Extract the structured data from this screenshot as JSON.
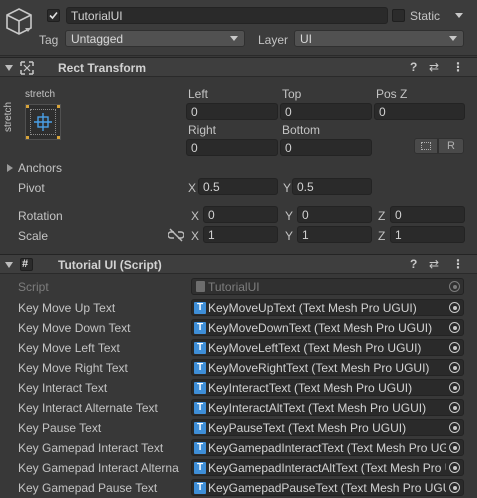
{
  "header": {
    "object_name": "TutorialUI",
    "active_checked": true,
    "static_label": "Static",
    "tag_label": "Tag",
    "tag_value": "Untagged",
    "layer_label": "Layer",
    "layer_value": "UI"
  },
  "rect_transform": {
    "title": "Rect Transform",
    "stretch_top": "stretch",
    "stretch_side": "stretch",
    "col_left": "Left",
    "col_top": "Top",
    "col_posz": "Pos Z",
    "left_value": "0",
    "top_value": "0",
    "posz_value": "0",
    "col_right": "Right",
    "col_bottom": "Bottom",
    "right_value": "0",
    "bottom_value": "0",
    "r_button": "R",
    "anchors_label": "Anchors",
    "pivot_label": "Pivot",
    "pivot_x_label": "X",
    "pivot_x": "0.5",
    "pivot_y_label": "Y",
    "pivot_y": "0.5",
    "rotation_label": "Rotation",
    "rot_x_label": "X",
    "rot_x": "0",
    "rot_y_label": "Y",
    "rot_y": "0",
    "rot_z_label": "Z",
    "rot_z": "0",
    "scale_label": "Scale",
    "scale_x_label": "X",
    "scale_x": "1",
    "scale_y_label": "Y",
    "scale_y": "1",
    "scale_z_label": "Z",
    "scale_z": "1"
  },
  "script_component": {
    "title": "Tutorial UI (Script)",
    "script_label": "Script",
    "script_value": "TutorialUI",
    "fields": [
      {
        "label": "Key Move Up Text",
        "value": "KeyMoveUpText (Text Mesh Pro UGUI)"
      },
      {
        "label": "Key Move Down Text",
        "value": "KeyMoveDownText (Text Mesh Pro UGUI)"
      },
      {
        "label": "Key Move Left Text",
        "value": "KeyMoveLeftText (Text Mesh Pro UGUI)"
      },
      {
        "label": "Key Move Right Text",
        "value": "KeyMoveRightText (Text Mesh Pro UGUI)"
      },
      {
        "label": "Key Interact Text",
        "value": "KeyInteractText (Text Mesh Pro UGUI)"
      },
      {
        "label": "Key Interact Alternate Text",
        "value": "KeyInteractAltText (Text Mesh Pro UGUI)"
      },
      {
        "label": "Key Pause Text",
        "value": "KeyPauseText (Text Mesh Pro UGUI)"
      },
      {
        "label": "Key Gamepad Interact Text",
        "value": "KeyGamepadInteractText (Text Mesh Pro UGUI)"
      },
      {
        "label": "Key Gamepad Interact Alterna",
        "value": "KeyGamepadInteractAltText (Text Mesh Pro UGUI)"
      },
      {
        "label": "Key Gamepad Pause Text",
        "value": "KeyGamepadPauseText (Text Mesh Pro UGUI)"
      }
    ]
  },
  "colors": {
    "background": "#383838",
    "field": "#2a2a2a",
    "header": "#3e3e3e",
    "accent_blue": "#3f8fd8"
  }
}
